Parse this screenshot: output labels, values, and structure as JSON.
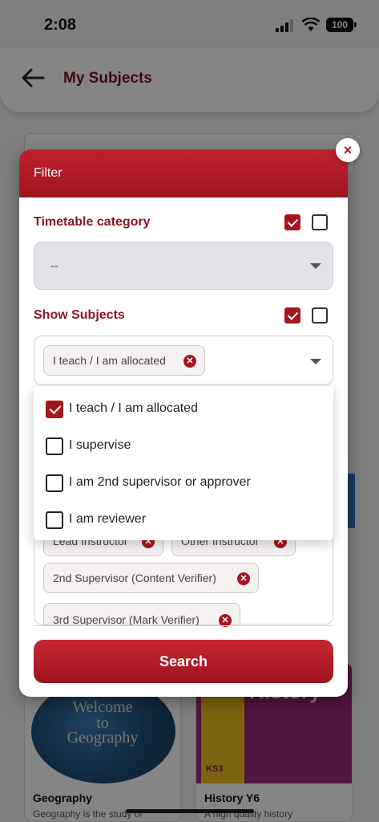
{
  "status": {
    "time": "2:08",
    "battery": "100"
  },
  "header": {
    "title": "My Subjects"
  },
  "background_cards": [
    {
      "image_text": [
        "Welcome",
        "to",
        "Geography"
      ],
      "title": "Geography",
      "desc": "Geography is the study of"
    },
    {
      "image_text": [
        "History",
        "KS3"
      ],
      "title": "History Y6",
      "desc": "A high quality history"
    }
  ],
  "modal": {
    "title": "Filter",
    "close_label": "×",
    "timetable": {
      "label": "Timetable category",
      "value": "--",
      "checkbox1_checked": true,
      "checkbox2_checked": false
    },
    "show_subjects": {
      "label": "Show Subjects",
      "checkbox1_checked": true,
      "checkbox2_checked": false,
      "selected_chip": "I teach / I am allocated",
      "options": [
        {
          "label": "I teach / I am allocated",
          "checked": true
        },
        {
          "label": "I supervise",
          "checked": false
        },
        {
          "label": "I am 2nd supervisor or approver",
          "checked": false
        },
        {
          "label": "I am reviewer",
          "checked": false
        }
      ]
    },
    "role_chips": [
      "Lead Instructor",
      "Other Instructor",
      "2nd Supervisor (Content Verifier)",
      "3rd Supervisor (Mark Verifier)"
    ],
    "search_label": "Search"
  },
  "colors": {
    "accent": "#a5161f",
    "title_text": "#7a1020"
  },
  "icons": {
    "back": "arrow-left-icon",
    "close": "close-icon",
    "caret": "caret-down-icon",
    "chip_remove": "remove-circle-icon"
  }
}
